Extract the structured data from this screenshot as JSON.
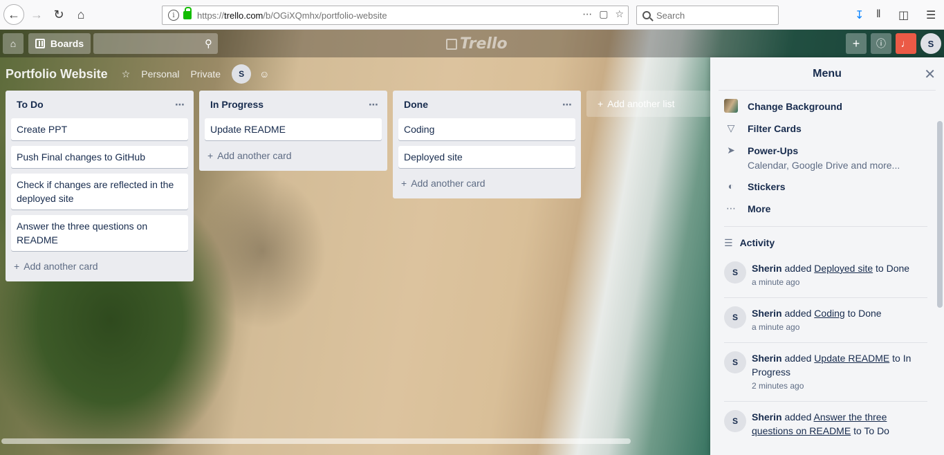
{
  "browser": {
    "url_prefix": "https://",
    "url_domain": "trello.com",
    "url_path": "/b/OGiXQmhx/portfolio-website",
    "search_placeholder": "Search"
  },
  "header": {
    "boards_label": "Boards",
    "logo_text": "Trello",
    "avatar": "S"
  },
  "board": {
    "title": "Portfolio Website",
    "team": "Personal",
    "visibility": "Private",
    "member": "S"
  },
  "lists": [
    {
      "title": "To Do",
      "cards": [
        "Create PPT",
        "Push Final changes to GitHub",
        "Check if changes are reflected in the deployed site",
        "Answer the three questions on README"
      ],
      "add_label": "Add another card"
    },
    {
      "title": "In Progress",
      "cards": [
        "Update README"
      ],
      "add_label": "Add another card"
    },
    {
      "title": "Done",
      "cards": [
        "Coding",
        "Deployed site"
      ],
      "add_label": "Add another card"
    }
  ],
  "add_list_label": "Add another list",
  "menu": {
    "title": "Menu",
    "items": [
      {
        "label": "Change Background",
        "icon": "background-thumb-icon"
      },
      {
        "label": "Filter Cards",
        "icon": "filter-icon"
      },
      {
        "label": "Power-Ups",
        "sub": "Calendar, Google Drive and more...",
        "icon": "rocket-icon"
      },
      {
        "label": "Stickers",
        "icon": "sticker-icon"
      },
      {
        "label": "More",
        "icon": "more-icon"
      }
    ],
    "activity_title": "Activity",
    "activity": [
      {
        "user": "Sherin",
        "verb": "added",
        "card": "Deployed site",
        "to_text": "to Done",
        "time": "a minute ago"
      },
      {
        "user": "Sherin",
        "verb": "added",
        "card": "Coding",
        "to_text": "to Done",
        "time": "a minute ago"
      },
      {
        "user": "Sherin",
        "verb": "added",
        "card": "Update README",
        "to_text": "to In Progress",
        "time": "2 minutes ago"
      },
      {
        "user": "Sherin",
        "verb": "added",
        "card": "Answer the three questions on README",
        "to_text": "to To Do",
        "time": ""
      }
    ]
  }
}
